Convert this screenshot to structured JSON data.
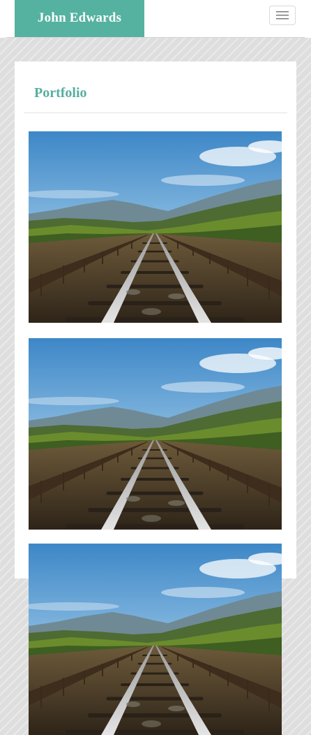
{
  "navbar": {
    "brand": "John Edwards",
    "toggle_icon": "hamburger-menu-icon",
    "brand_color": "#55b2a0"
  },
  "portfolio": {
    "title": "Portfolio",
    "title_color": "#58aea0",
    "items": [
      {
        "image": "railway-bridge-landscape-photo"
      },
      {
        "image": "railway-bridge-landscape-photo"
      },
      {
        "image": "railway-bridge-landscape-photo"
      }
    ]
  }
}
